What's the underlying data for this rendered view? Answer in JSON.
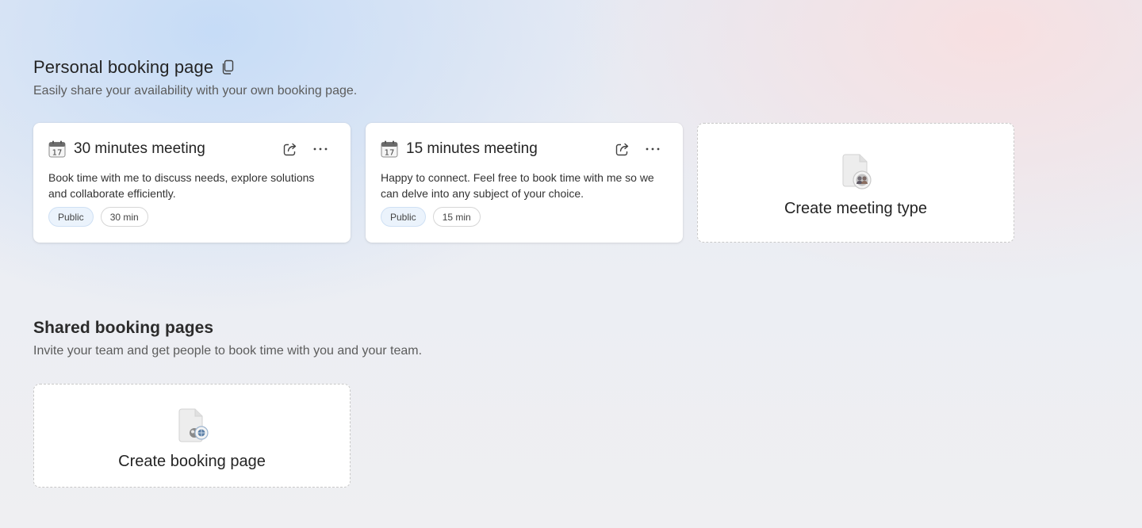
{
  "personal": {
    "title": "Personal booking page",
    "subtitle": "Easily share your availability with your own booking page.",
    "copy_icon": "copy-icon",
    "meetings": [
      {
        "title": "30 minutes meeting",
        "description": "Book time with me to discuss needs, explore solutions and collaborate efficiently.",
        "visibility": "Public",
        "duration": "30 min",
        "calendar_day": "17"
      },
      {
        "title": "15 minutes meeting",
        "description": "Happy to connect. Feel free to book time with me so we can delve into any subject of your choice.",
        "visibility": "Public",
        "duration": "15 min",
        "calendar_day": "17"
      }
    ],
    "create_label": "Create meeting type"
  },
  "shared": {
    "title": "Shared booking pages",
    "subtitle": "Invite your team and get people to book time with you and your team.",
    "create_label": "Create booking page"
  },
  "colors": {
    "accent": "#0f6cbd",
    "pill_public_bg": "#ebf3fc"
  },
  "icons": [
    "copy-icon",
    "calendar-icon",
    "share-icon",
    "more-icon"
  ]
}
